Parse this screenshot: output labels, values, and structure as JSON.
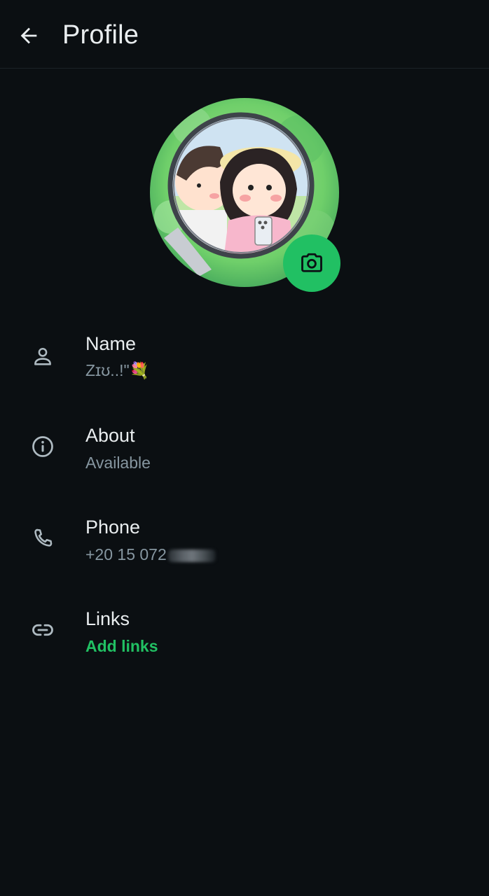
{
  "header": {
    "title": "Profile",
    "back_icon": "arrow-left-icon"
  },
  "avatar": {
    "camera_icon": "camera-icon",
    "accent": "#21c063"
  },
  "rows": [
    {
      "icon": "person-icon",
      "label": "Name",
      "value": "Zɪʊ..!\"💐"
    },
    {
      "icon": "info-icon",
      "label": "About",
      "value": "Available"
    },
    {
      "icon": "phone-icon",
      "label": "Phone",
      "value": "+20 15 072"
    },
    {
      "icon": "link-icon",
      "label": "Links",
      "value": "Add links"
    }
  ],
  "colors": {
    "background": "#0b0f12",
    "primary_text": "#e9edef",
    "secondary_text": "#8696a0",
    "accent": "#21c063"
  }
}
